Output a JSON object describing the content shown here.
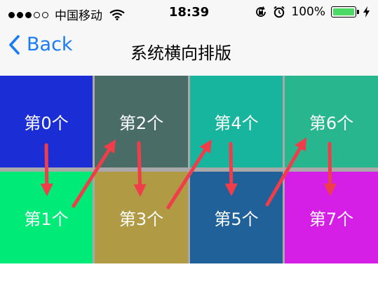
{
  "status_bar": {
    "carrier": "中国移动",
    "time": "18:39",
    "battery": "100%",
    "signal_bars_filled": 3,
    "signal_bars_total": 5,
    "battery_level": 1.0,
    "icons": [
      "wifi-icon",
      "orientation-lock-icon",
      "alarm-icon",
      "battery-icon",
      "charging-bolt-icon"
    ]
  },
  "nav": {
    "back_label": "Back",
    "title": "系统横向排版"
  },
  "grid": {
    "items": [
      {
        "label": "第0个",
        "color": "#1b2ed6"
      },
      {
        "label": "第1个",
        "color": "#00ea78"
      },
      {
        "label": "第2个",
        "color": "#4a6c67"
      },
      {
        "label": "第3个",
        "color": "#b09a43"
      },
      {
        "label": "第4个",
        "color": "#17b59e"
      },
      {
        "label": "第5个",
        "color": "#20619a"
      },
      {
        "label": "第6个",
        "color": "#28b68f"
      },
      {
        "label": "第7个",
        "color": "#d61fe6"
      }
    ]
  },
  "colors": {
    "arrow": "#f03d4a",
    "nav_tint": "#1a7cf5",
    "gap": "#a9a9a9"
  }
}
